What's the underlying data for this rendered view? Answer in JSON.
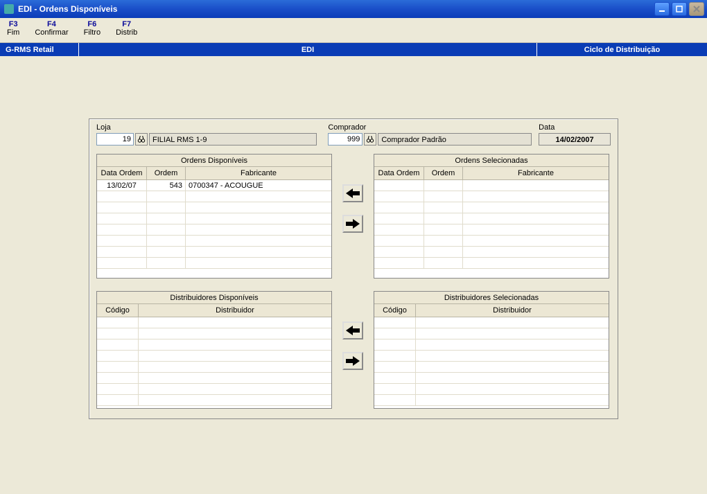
{
  "window": {
    "title": "EDI - Ordens Disponíveis"
  },
  "toolbar": [
    {
      "fk": "F3",
      "label": "Fim"
    },
    {
      "fk": "F4",
      "label": "Confirmar"
    },
    {
      "fk": "F6",
      "label": "Filtro"
    },
    {
      "fk": "F7",
      "label": "Distrib"
    }
  ],
  "bluebar": {
    "left": "G-RMS Retail",
    "center": "EDI",
    "right": "Ciclo de Distribuição"
  },
  "fields": {
    "loja": {
      "label": "Loja",
      "value": "19",
      "name": "FILIAL RMS 1-9"
    },
    "comprador": {
      "label": "Comprador",
      "value": "999",
      "name": "Comprador Padrão"
    },
    "data": {
      "label": "Data",
      "value": "14/02/2007"
    }
  },
  "ordens_disp": {
    "title": "Ordens Disponíveis",
    "cols": [
      "Data Ordem",
      "Ordem",
      "Fabricante"
    ],
    "rows": [
      {
        "data": "13/02/07",
        "ordem": "543",
        "fab": "0700347 - ACOUGUE"
      }
    ]
  },
  "ordens_sel": {
    "title": "Ordens Selecionadas",
    "cols": [
      "Data Ordem",
      "Ordem",
      "Fabricante"
    ],
    "rows": []
  },
  "dist_disp": {
    "title": "Distribuidores Disponíveis",
    "cols": [
      "Código",
      "Distribuidor"
    ],
    "rows": []
  },
  "dist_sel": {
    "title": "Distribuidores Selecionadas",
    "cols": [
      "Código",
      "Distribuidor"
    ],
    "rows": []
  }
}
